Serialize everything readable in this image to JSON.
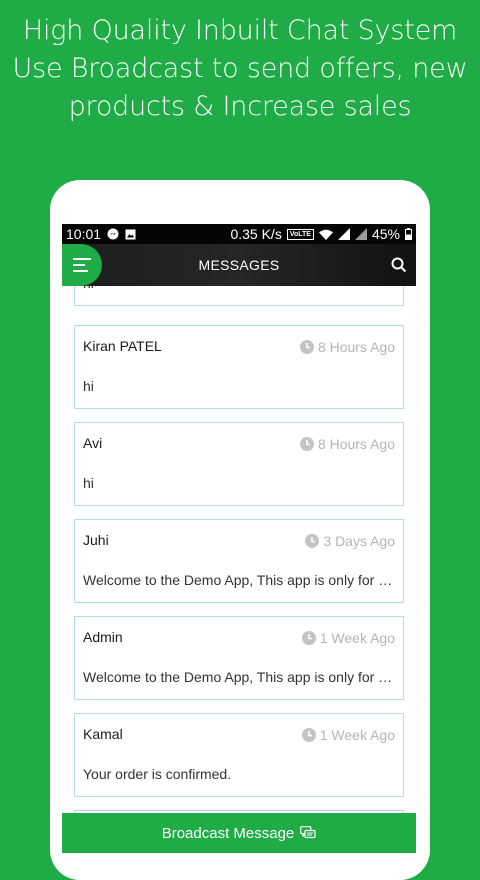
{
  "promo": {
    "line1": "High Quality Inbuilt Chat System",
    "line2": "Use Broadcast to send offers, new",
    "line3": "products & Increase sales"
  },
  "status_bar": {
    "time": "10:01",
    "speed": "0.35 K/s",
    "volte": "VoLTE",
    "battery": "45%"
  },
  "app_bar": {
    "title": "MESSAGES",
    "menu_icon": "hamburger-icon",
    "search_icon": "search-icon"
  },
  "messages": [
    {
      "name": "",
      "time": "",
      "text": "hi"
    },
    {
      "name": "Kiran PATEL",
      "time": "8 Hours Ago",
      "text": "hi"
    },
    {
      "name": "Avi",
      "time": "8 Hours Ago",
      "text": "hi"
    },
    {
      "name": "Juhi",
      "time": "3 Days Ago",
      "text": "Welcome to the Demo App, This app is only for demo purpose"
    },
    {
      "name": "Admin",
      "time": "1 Week Ago",
      "text": "Welcome to the Demo App, This app is only for demo purpose"
    },
    {
      "name": "Kamal",
      "time": "1 Week Ago",
      "text": "Your order is confirmed."
    }
  ],
  "broadcast": {
    "label": "Broadcast Message",
    "icon": "chat-bubbles-icon"
  },
  "colors": {
    "brand_green": "#1fab45",
    "card_border": "#b3dde6",
    "time_grey": "#b5b5b5"
  }
}
